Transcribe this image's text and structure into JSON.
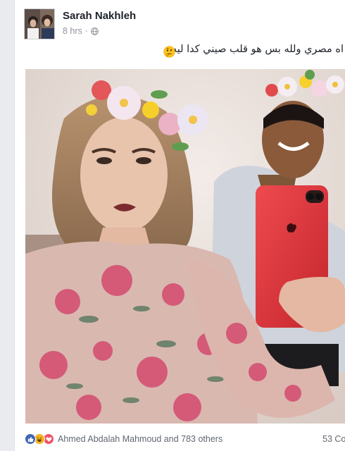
{
  "post": {
    "author": "Sarah Nakhleh",
    "time": "8 hrs",
    "separator": "·",
    "privacy_icon": "globe-icon",
    "text": "اه مصري ولله بس هو قلب صيني كدا ليه",
    "emoji": "thinking-face",
    "photo_alt": "Selfie photo",
    "reactions": {
      "icons": [
        "like-icon",
        "haha-icon",
        "love-icon"
      ],
      "summary": "Ahmed Abdalah Mahmoud and 783 others"
    },
    "comments_count": "53 Co"
  },
  "colors": {
    "name": "#1d2129",
    "meta": "#90949c",
    "like": "#4267b2",
    "haha": "#f7b125",
    "love": "#f25268",
    "phone": "#e0353b"
  }
}
